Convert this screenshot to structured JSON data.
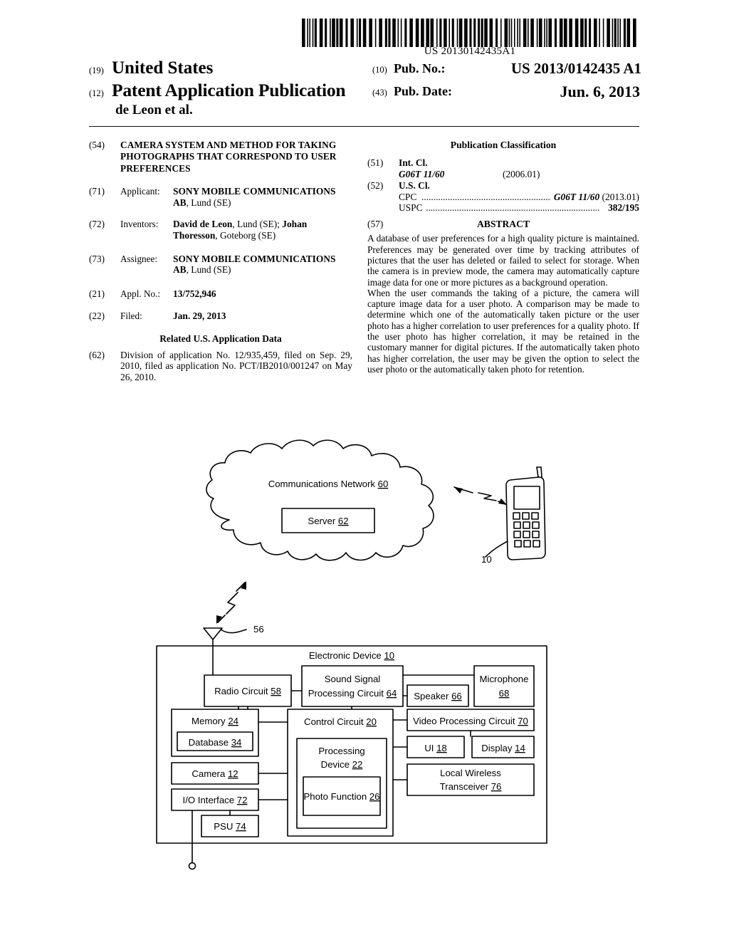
{
  "barcode": {
    "number": "US 20130142435A1"
  },
  "header": {
    "tag19": "(19)",
    "country": "United States",
    "tag12": "(12)",
    "doc_type": "Patent Application Publication",
    "authors": "de Leon et al.",
    "tag10": "(10)",
    "pub_no_label": "Pub. No.:",
    "pub_no_value": "US 2013/0142435 A1",
    "tag43": "(43)",
    "pub_date_label": "Pub. Date:",
    "pub_date_value": "Jun. 6, 2013"
  },
  "left": {
    "title_num": "(54)",
    "title": "CAMERA SYSTEM AND METHOD FOR TAKING PHOTOGRAPHS THAT CORRESPOND TO USER PREFERENCES",
    "applicant_num": "(71)",
    "applicant_label": "Applicant:",
    "applicant_bold": "SONY MOBILE COMMUNICATIONS AB",
    "applicant_rest": ", Lund (SE)",
    "inventors_num": "(72)",
    "inventors_label": "Inventors:",
    "inventor1_bold": "David de Leon",
    "inventor1_rest": ", Lund (SE); ",
    "inventor2_bold": "Johan Thoresson",
    "inventor2_rest": ", Goteborg (SE)",
    "assignee_num": "(73)",
    "assignee_label": "Assignee:",
    "assignee_bold": "SONY MOBILE COMMUNICATIONS AB",
    "assignee_rest": ", Lund (SE)",
    "appl_num": "(21)",
    "appl_label": "Appl. No.:",
    "appl_value": "13/752,946",
    "filed_num": "(22)",
    "filed_label": "Filed:",
    "filed_value": "Jan. 29, 2013",
    "related_heading": "Related U.S. Application Data",
    "division_num": "(62)",
    "division_text": "Division of application No. 12/935,459, filed on Sep. 29, 2010, filed as application No. PCT/IB2010/001247 on May 26, 2010."
  },
  "right": {
    "pub_class_heading": "Publication Classification",
    "intcl_num": "(51)",
    "intcl_label": "Int. Cl.",
    "intcl_code": "G06T 11/60",
    "intcl_version": "(2006.01)",
    "uscl_num": "(52)",
    "uscl_label": "U.S. Cl.",
    "cpc_label": "CPC",
    "cpc_code": "G06T 11/60",
    "cpc_version": "(2013.01)",
    "uspc_label": "USPC",
    "uspc_value": "382/195",
    "abstract_num": "(57)",
    "abstract_heading": "ABSTRACT",
    "abstract_p1": "A database of user preferences for a high quality picture is maintained. Preferences may be generated over time by tracking attributes of pictures that the user has deleted or failed to select for storage. When the camera is in preview mode, the camera may automatically capture image data for one or more pictures as a background operation.",
    "abstract_p2": "When the user commands the taking of a picture, the camera will capture image data for a user photo. A comparison may be made to determine which one of the automatically taken picture or the user photo has a higher correlation to user preferences for a quality photo. If the user photo has higher correlation, it may be retained in the customary manner for digital pictures. If the automatically taken photo has higher correlation, the user may be given the option to select the user photo or the automatically taken photo for retention."
  },
  "figure": {
    "cloud_label": "Communications Network ",
    "cloud_ref": "60",
    "server_label": "Server ",
    "server_ref": "62",
    "phone_ref": "10",
    "antenna_ref": "56",
    "device_label": "Electronic Device ",
    "device_ref": "10",
    "blocks": [
      {
        "name": "radio-circuit",
        "text": "Radio Circuit ",
        "ref": "58"
      },
      {
        "name": "sound-signal",
        "text": "Sound Signal",
        "text2": "Processing Circuit ",
        "ref": "64"
      },
      {
        "name": "speaker",
        "text": "Speaker ",
        "ref": "66"
      },
      {
        "name": "microphone",
        "text": "Microphone",
        "text2": "",
        "ref": "68"
      },
      {
        "name": "memory",
        "text": "Memory ",
        "ref": "24"
      },
      {
        "name": "database",
        "text": "Database ",
        "ref": "34"
      },
      {
        "name": "camera",
        "text": "Camera ",
        "ref": "12"
      },
      {
        "name": "io-interface",
        "text": "I/O Interface ",
        "ref": "72"
      },
      {
        "name": "psu",
        "text": "PSU ",
        "ref": "74"
      },
      {
        "name": "control-circuit",
        "text": "Control Circuit ",
        "ref": "20"
      },
      {
        "name": "processing-device",
        "text": "Processing",
        "text2": "Device ",
        "ref": "22"
      },
      {
        "name": "photo-function",
        "text": "Photo Function ",
        "ref": "26"
      },
      {
        "name": "video-processing",
        "text": "Video Processing Circuit ",
        "ref": "70"
      },
      {
        "name": "ui",
        "text": "UI ",
        "ref": "18"
      },
      {
        "name": "display",
        "text": "Display ",
        "ref": "14"
      },
      {
        "name": "local-wireless",
        "text": "Local Wireless",
        "text2": "Transceiver ",
        "ref": "76"
      }
    ]
  }
}
